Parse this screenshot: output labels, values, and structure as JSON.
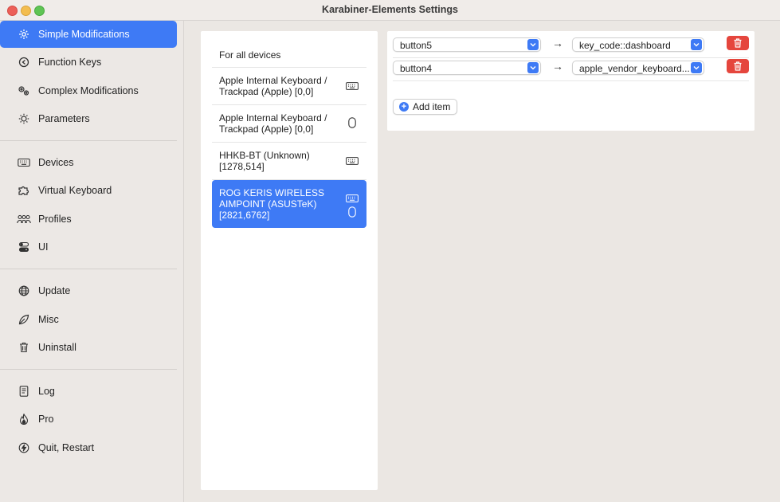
{
  "window": {
    "title": "Karabiner-Elements Settings"
  },
  "sidebar": {
    "items": [
      {
        "label": "Simple Modifications",
        "icon": "gear-icon",
        "active": true
      },
      {
        "label": "Function Keys",
        "icon": "function-keys-icon",
        "active": false
      },
      {
        "label": "Complex Modifications",
        "icon": "gears-icon",
        "active": false
      },
      {
        "label": "Parameters",
        "icon": "sun-icon",
        "active": false
      },
      {
        "label": "Devices",
        "icon": "keyboard-icon",
        "active": false
      },
      {
        "label": "Virtual Keyboard",
        "icon": "puzzle-icon",
        "active": false
      },
      {
        "label": "Profiles",
        "icon": "people-icon",
        "active": false
      },
      {
        "label": "UI",
        "icon": "toggles-icon",
        "active": false
      },
      {
        "label": "Update",
        "icon": "globe-icon",
        "active": false
      },
      {
        "label": "Misc",
        "icon": "leaf-icon",
        "active": false
      },
      {
        "label": "Uninstall",
        "icon": "trash-icon",
        "active": false
      },
      {
        "label": "Log",
        "icon": "document-icon",
        "active": false
      },
      {
        "label": "Pro",
        "icon": "flame-icon",
        "active": false
      },
      {
        "label": "Quit, Restart",
        "icon": "bolt-icon",
        "active": false
      }
    ]
  },
  "devices": {
    "items": [
      {
        "label": "For all devices",
        "icons": []
      },
      {
        "label": "Apple Internal Keyboard / Trackpad (Apple) [0,0]",
        "icons": [
          "keyboard-icon"
        ]
      },
      {
        "label": "Apple Internal Keyboard / Trackpad (Apple) [0,0]",
        "icons": [
          "mouse-icon"
        ]
      },
      {
        "label": "HHKB-BT (Unknown) [1278,514]",
        "icons": [
          "keyboard-icon"
        ]
      },
      {
        "label": "ROG KERIS WIRELESS AIMPOINT (ASUSTeK) [2821,6762]",
        "icons": [
          "keyboard-icon",
          "mouse-icon"
        ],
        "selected": true
      }
    ]
  },
  "modifications": {
    "rows": [
      {
        "from": "button5",
        "to": "key_code::dashboard"
      },
      {
        "from": "button4",
        "to": "apple_vendor_keyboard..."
      }
    ],
    "add_item_label": "Add item"
  },
  "colors": {
    "accent": "#3e7af5",
    "danger": "#e5463d"
  }
}
